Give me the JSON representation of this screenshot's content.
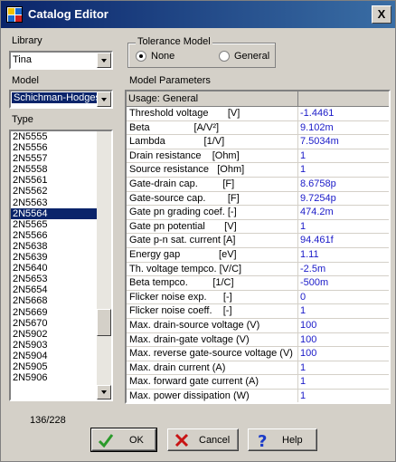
{
  "window": {
    "title": "Catalog Editor",
    "close_glyph": "X"
  },
  "library": {
    "label": "Library",
    "value": "Tina"
  },
  "model": {
    "label": "Model",
    "value": "Schichman-Hodges"
  },
  "type": {
    "label": "Type",
    "items": [
      "2N5555",
      "2N5556",
      "2N5557",
      "2N5558",
      "2N5561",
      "2N5562",
      "2N5563",
      "2N5564",
      "2N5565",
      "2N5566",
      "2N5638",
      "2N5639",
      "2N5640",
      "2N5653",
      "2N5654",
      "2N5668",
      "2N5669",
      "2N5670",
      "2N5902",
      "2N5903",
      "2N5904",
      "2N5905",
      "2N5906"
    ],
    "selected": "2N5564",
    "counter": "136/228"
  },
  "tolerance": {
    "title": "Tolerance Model",
    "options": [
      "None",
      "General"
    ],
    "selected": "None"
  },
  "parameters": {
    "title": "Model Parameters",
    "header": "Usage: General",
    "rows": [
      {
        "name": "Threshold voltage       [V]",
        "value": "-1.4461"
      },
      {
        "name": "Beta                [A/V²]",
        "value": "9.102m"
      },
      {
        "name": "Lambda              [1/V]",
        "value": "7.5034m"
      },
      {
        "name": "Drain resistance    [Ohm]",
        "value": "1"
      },
      {
        "name": "Source resistance   [Ohm]",
        "value": "1"
      },
      {
        "name": "Gate-drain cap.         [F]",
        "value": "8.6758p"
      },
      {
        "name": "Gate-source cap.        [F]",
        "value": "9.7254p"
      },
      {
        "name": "Gate pn grading coef. [-]",
        "value": "474.2m"
      },
      {
        "name": "Gate pn potential       [V]",
        "value": "1"
      },
      {
        "name": "Gate p-n sat. current [A]",
        "value": "94.461f"
      },
      {
        "name": "Energy gap              [eV]",
        "value": "1.11"
      },
      {
        "name": "Th. voltage tempco. [V/C]",
        "value": "-2.5m"
      },
      {
        "name": "Beta tempco.         [1/C]",
        "value": "-500m"
      },
      {
        "name": "Flicker noise exp.      [-]",
        "value": "0"
      },
      {
        "name": "Flicker noise coeff.    [-]",
        "value": "1"
      },
      {
        "name": "Max. drain-source voltage (V)",
        "value": "100"
      },
      {
        "name": "Max. drain-gate voltage (V)",
        "value": "100"
      },
      {
        "name": "Max. reverse gate-source voltage (V)",
        "value": "100"
      },
      {
        "name": "Max. drain current (A)",
        "value": "1"
      },
      {
        "name": "Max. forward gate current (A)",
        "value": "1"
      },
      {
        "name": "Max. power dissipation (W)",
        "value": "1"
      }
    ]
  },
  "buttons": {
    "ok": "OK",
    "cancel": "Cancel",
    "help": "Help"
  },
  "icons": {
    "ok": "checkmark-icon",
    "cancel": "x-icon",
    "help": "question-mark-icon"
  },
  "colors": {
    "titlebar": "#0a246a",
    "selection": "#0a246a",
    "value_text": "#1a1ac8",
    "ok_icon": "#2a9a2a",
    "cancel_icon": "#c81414",
    "help_icon": "#1a3ac8"
  }
}
